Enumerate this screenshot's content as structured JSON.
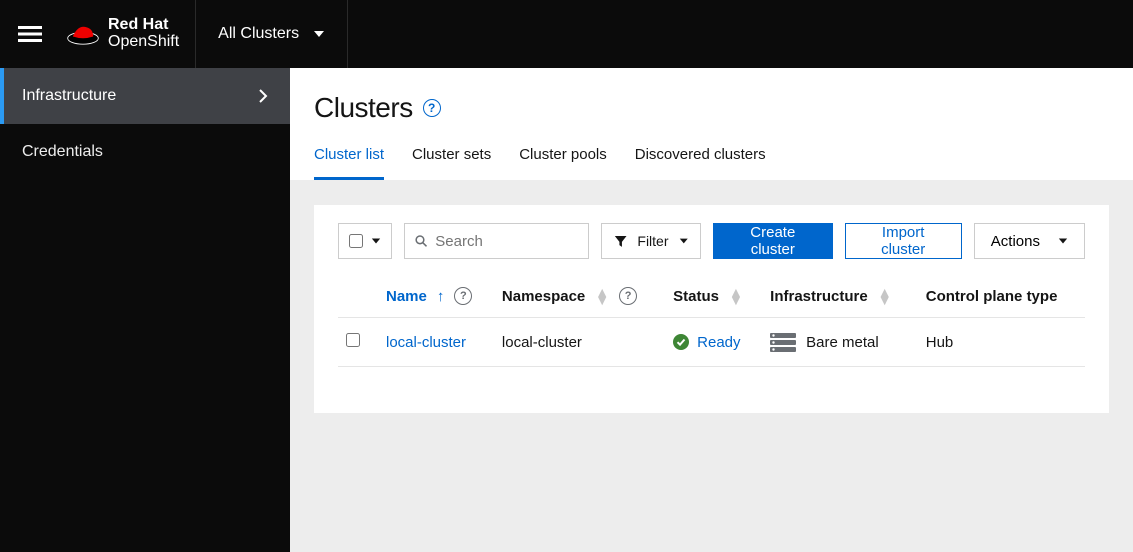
{
  "brand": {
    "line1": "Red Hat",
    "line2": "OpenShift"
  },
  "context": {
    "label": "All Clusters"
  },
  "sidebar": {
    "items": [
      {
        "label": "Infrastructure"
      },
      {
        "label": "Credentials"
      }
    ]
  },
  "page": {
    "title": "Clusters"
  },
  "tabs": [
    {
      "label": "Cluster list"
    },
    {
      "label": "Cluster sets"
    },
    {
      "label": "Cluster pools"
    },
    {
      "label": "Discovered clusters"
    }
  ],
  "toolbar": {
    "search_placeholder": "Search",
    "filter_label": "Filter",
    "create_label": "Create cluster",
    "import_label": "Import cluster",
    "actions_label": "Actions"
  },
  "table": {
    "columns": {
      "name": "Name",
      "namespace": "Namespace",
      "status": "Status",
      "infrastructure": "Infrastructure",
      "control_plane": "Control plane type"
    },
    "rows": [
      {
        "name": "local-cluster",
        "namespace": "local-cluster",
        "status": "Ready",
        "infrastructure": "Bare metal",
        "control_plane": "Hub"
      }
    ]
  }
}
